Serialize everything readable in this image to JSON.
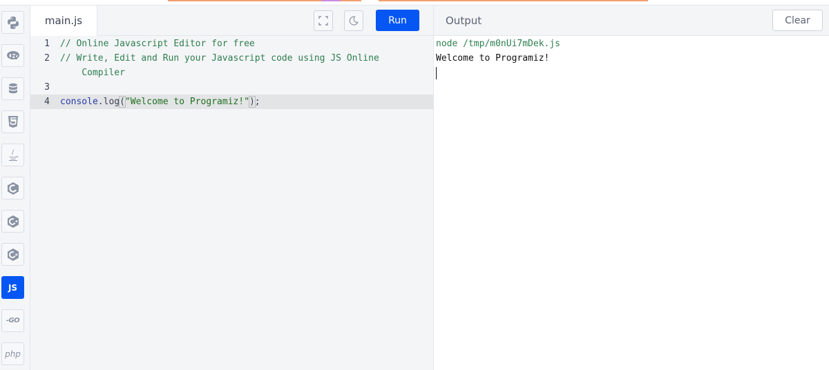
{
  "sidebar": {
    "languages": [
      {
        "name": "python-icon"
      },
      {
        "name": "r-icon"
      },
      {
        "name": "sql-icon"
      },
      {
        "name": "html5-icon"
      },
      {
        "name": "java-icon"
      },
      {
        "name": "c-icon"
      },
      {
        "name": "cpp-icon"
      },
      {
        "name": "csharp-icon"
      },
      {
        "name": "js",
        "label": "JS",
        "active": true
      },
      {
        "name": "go",
        "label": "-GO"
      },
      {
        "name": "php",
        "label": "php"
      }
    ]
  },
  "editor": {
    "file_name": "main.js",
    "run_label": "Run",
    "lines": [
      {
        "num": "1",
        "text": "// Online Javascript Editor for free"
      },
      {
        "num": "2",
        "text": "// Write, Edit and Run your Javascript code using JS Online",
        "cont": "    Compiler"
      },
      {
        "num": "3",
        "text": ""
      },
      {
        "num": "4",
        "parts": [
          "console",
          ".",
          "log",
          "(",
          "\"Welcome to Programiz!\"",
          ")",
          ";"
        ]
      }
    ]
  },
  "output": {
    "title": "Output",
    "clear_label": "Clear",
    "command": "node /tmp/m0nUi7mDek.js",
    "result": "Welcome to Programiz!"
  },
  "colors": {
    "accent": "#0556f3",
    "comment": "#2e7d4f",
    "string": "#1f6f1f"
  }
}
